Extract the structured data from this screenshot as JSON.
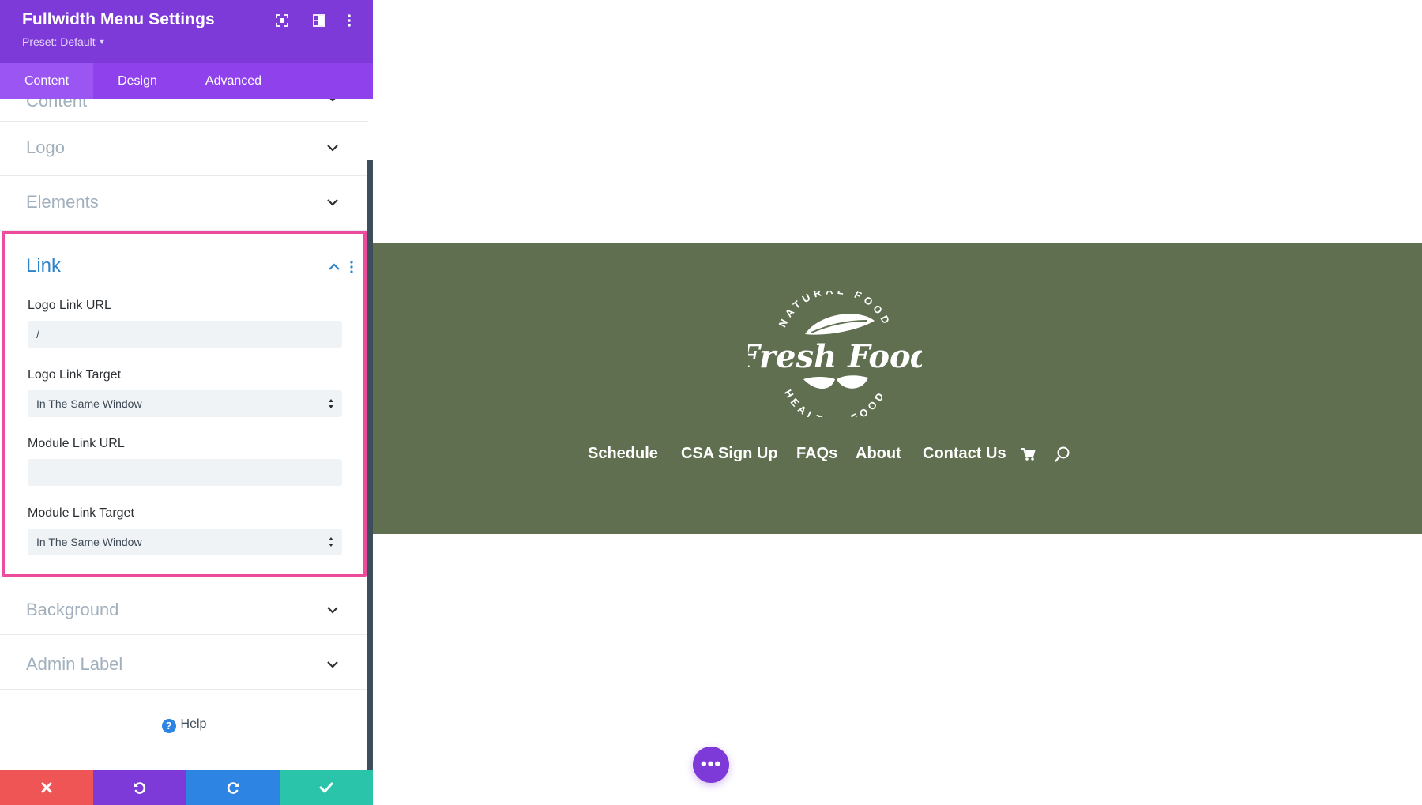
{
  "panel": {
    "title": "Fullwidth Menu Settings",
    "preset": "Preset: Default",
    "header_icons": [
      "expand-icon",
      "split-view-icon",
      "more-vertical-icon"
    ],
    "tabs": [
      {
        "label": "Content",
        "active": true
      },
      {
        "label": "Design",
        "active": false
      },
      {
        "label": "Advanced",
        "active": false
      }
    ],
    "toggles_above": [
      {
        "label": "Content",
        "open": false
      },
      {
        "label": "Logo",
        "open": false
      },
      {
        "label": "Elements",
        "open": false
      }
    ],
    "link_section": {
      "title": "Link",
      "open": true,
      "highlight_color": "#ec4c9b",
      "fields": {
        "logo_link_url": {
          "label": "Logo Link URL",
          "value": "/"
        },
        "logo_link_target": {
          "label": "Logo Link Target",
          "value": "In The Same Window"
        },
        "module_link_url": {
          "label": "Module Link URL",
          "value": ""
        },
        "module_link_target": {
          "label": "Module Link Target",
          "value": "In The Same Window"
        }
      }
    },
    "toggles_below": [
      {
        "label": "Background",
        "open": false
      },
      {
        "label": "Admin Label",
        "open": false
      }
    ],
    "help_label": "Help",
    "help_icon": "question-circle-icon",
    "actions": [
      {
        "name": "discard",
        "icon": "close-icon",
        "color": "#ef5555"
      },
      {
        "name": "undo",
        "icon": "undo-icon",
        "color": "#7d3ad8"
      },
      {
        "name": "redo",
        "icon": "redo-icon",
        "color": "#2e84e2"
      },
      {
        "name": "save",
        "icon": "check-icon",
        "color": "#29c4a9"
      }
    ],
    "colors": {
      "header": "#7d3ad8",
      "tabs": "#8f42ec",
      "active_tab": "#9a55f2"
    }
  },
  "preview": {
    "hero_color": "#606f50",
    "logo": {
      "top_arc": "NATURAL FOOD",
      "wordmark": "Fresh Food",
      "bottom_arc": "HEALTHY FOOD"
    },
    "menu": [
      "Schedule",
      "CSA Sign Up",
      "FAQs",
      "About",
      "Contact Us"
    ],
    "menu_icons": [
      "cart-icon",
      "search-icon"
    ],
    "fab_label": "•••"
  }
}
